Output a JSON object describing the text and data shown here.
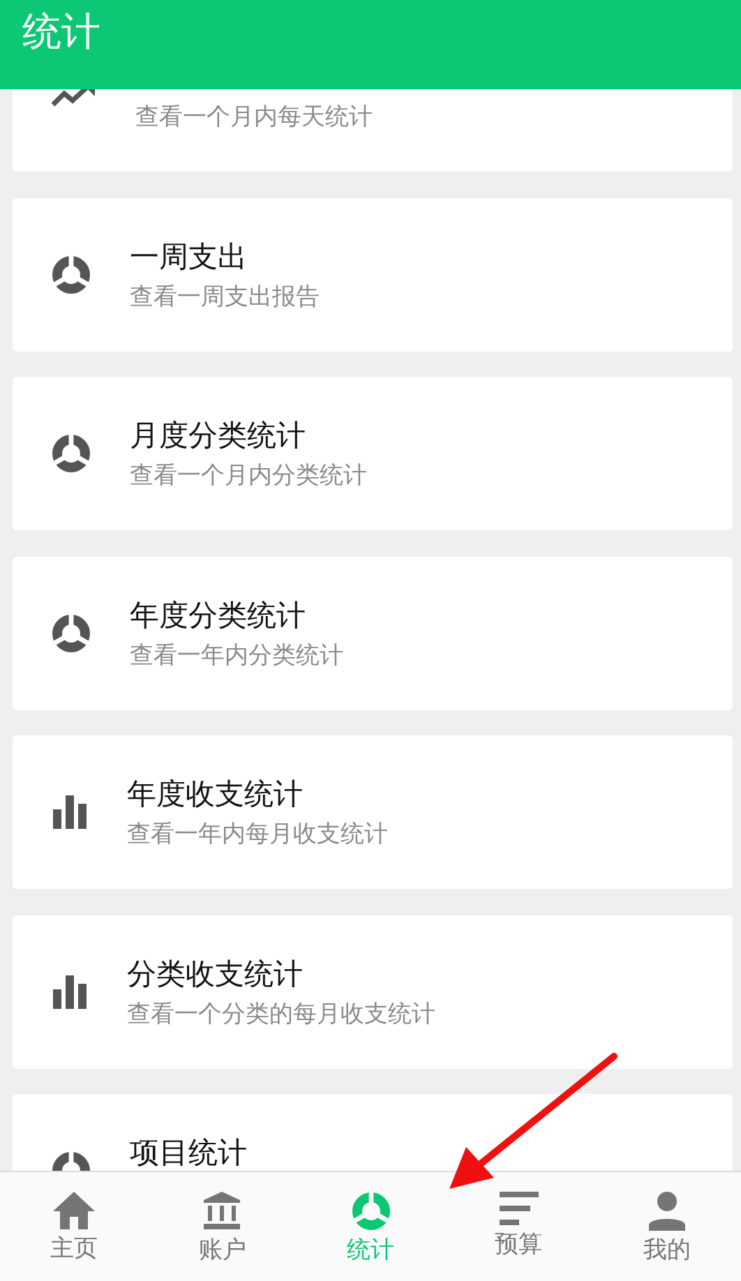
{
  "header": {
    "title": "统计"
  },
  "cards": [
    {
      "kind": "trend",
      "subtitle": "查看一个月内每天统计"
    },
    {
      "kind": "donut",
      "title": "一周支出",
      "subtitle": "查看一周支出报告"
    },
    {
      "kind": "donut",
      "title": "月度分类统计",
      "subtitle": "查看一个月内分类统计"
    },
    {
      "kind": "donut",
      "title": "年度分类统计",
      "subtitle": "查看一年内分类统计"
    },
    {
      "kind": "bars",
      "title": "年度收支统计",
      "subtitle": "查看一年内每月收支统计"
    },
    {
      "kind": "bars",
      "title": "分类收支统计",
      "subtitle": "查看一个分类的每月收支统计"
    },
    {
      "kind": "donut",
      "title": "项目统计"
    }
  ],
  "nav": [
    {
      "kind": "home",
      "label": "主页",
      "selected": false
    },
    {
      "kind": "bank",
      "label": "账户",
      "selected": false
    },
    {
      "kind": "donut",
      "label": "统计",
      "selected": true
    },
    {
      "kind": "sort",
      "label": "预算",
      "selected": false
    },
    {
      "kind": "person",
      "label": "我的",
      "selected": false
    }
  ]
}
